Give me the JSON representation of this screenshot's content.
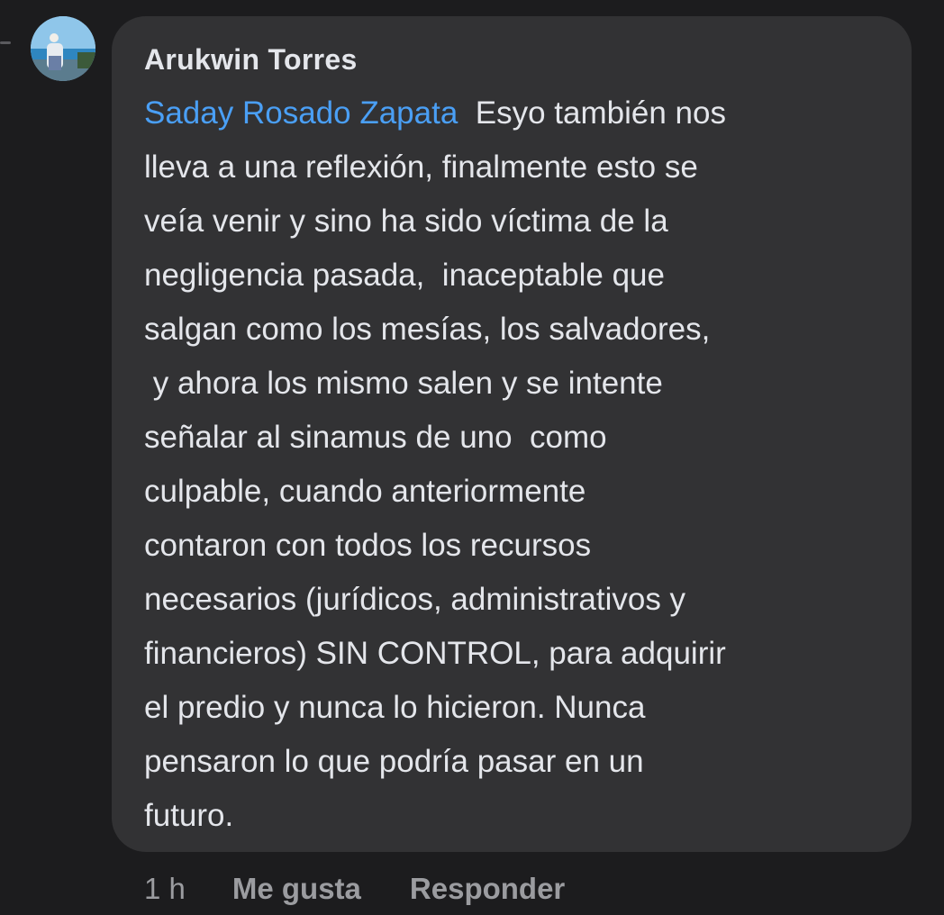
{
  "comment": {
    "author": "Arukwin Torres",
    "mention": "Saday Rosado Zapata",
    "lines": [
      "  Esyo también nos",
      "lleva a una reflexión, finalmente esto se",
      "veía venir y sino ha sido víctima de la",
      "negligencia pasada,  inaceptable que",
      "salgan como los mesías, los salvadores,",
      " y ahora los mismo salen y se intente",
      "señalar al sinamus de uno  como",
      "culpable, cuando anteriormente",
      "contaron con todos los recursos",
      "necesarios (jurídicos, administrativos y",
      "financieros) SIN CONTROL, para adquirir",
      "el predio y nunca lo hicieron. Nunca",
      "pensaron lo que podría pasar en un",
      "futuro."
    ]
  },
  "actions": {
    "time": "1 h",
    "like_label": "Me gusta",
    "reply_label": "Responder"
  },
  "colors": {
    "background": "#1c1c1e",
    "bubble": "#323234",
    "text": "#e4e6eb",
    "mention": "#4a9ff5",
    "meta": "#9b9ca0"
  }
}
